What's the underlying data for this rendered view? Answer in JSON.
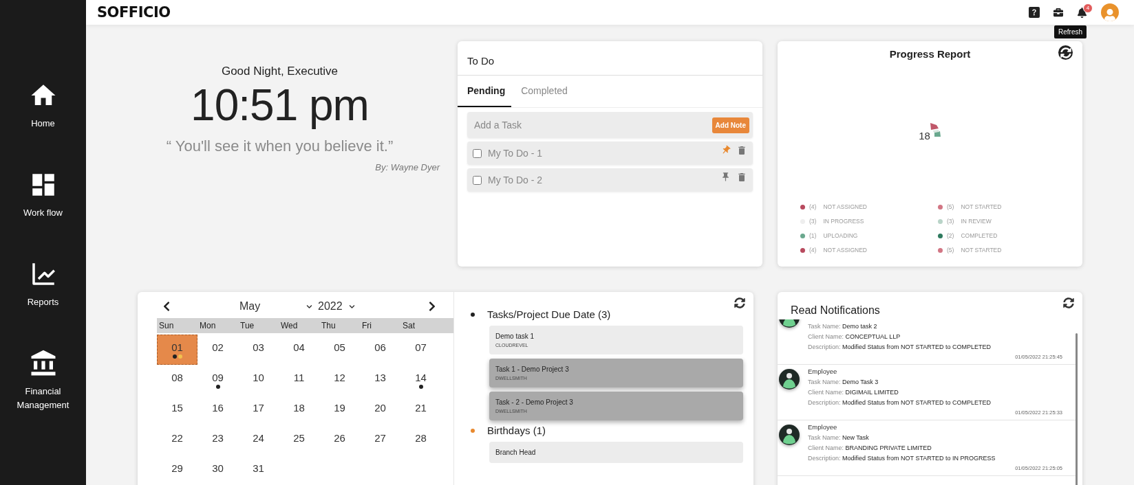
{
  "app": {
    "logo": "SOFFICIO"
  },
  "sidebar": {
    "items": [
      {
        "label": "Home",
        "kind": "home"
      },
      {
        "label": "Work flow",
        "kind": "workflow"
      },
      {
        "label": "Reports",
        "kind": "reports"
      },
      {
        "label": "Financial Management",
        "kind": "finance"
      }
    ]
  },
  "topbar": {
    "notification_count": "4"
  },
  "greeting": {
    "salutation": "Good Night, Executive",
    "time": "10:51 pm",
    "quote": "“ You'll see it when you believe it.”",
    "author": "By: Wayne Dyer"
  },
  "todo": {
    "title": "To Do",
    "tabs": [
      {
        "label": "Pending",
        "selected": true
      },
      {
        "label": "Completed",
        "selected": false
      }
    ],
    "input": {
      "placeholder": "Add a Task"
    },
    "add_button": "Add Note",
    "items": [
      {
        "label": "My To Do - 1",
        "checked": false,
        "pinned": true
      },
      {
        "label": "My To Do - 2",
        "checked": false,
        "pinned": false
      }
    ]
  },
  "progress_report": {
    "title": "Progress Report",
    "tooltip": "Refresh",
    "total": "18",
    "legend": [
      {
        "count": "(4)",
        "label": "NOT ASSIGNED",
        "color": "#b84a5e"
      },
      {
        "count": "(5)",
        "label": "NOT STARTED",
        "color": "#d27684"
      },
      {
        "count": "(3)",
        "label": "IN PROGRESS",
        "color": "#eeeeee"
      },
      {
        "count": "(3)",
        "label": "IN REVIEW",
        "color": "#b9d4c8"
      },
      {
        "count": "(1)",
        "label": "UPLOADING",
        "color": "#6aa88e"
      },
      {
        "count": "(2)",
        "label": "COMPLETED",
        "color": "#2e7a5e"
      },
      {
        "count": "(4)",
        "label": "NOT ASSIGNED",
        "color": "#b84a5e"
      },
      {
        "count": "(5)",
        "label": "NOT STARTED",
        "color": "#d27684"
      }
    ]
  },
  "calendar": {
    "month": "May",
    "year": "2022",
    "weekdays": [
      "Sun",
      "Mon",
      "Tue",
      "Wed",
      "Thu",
      "Fri",
      "Sat"
    ],
    "days": [
      {
        "day": "01",
        "selected": true,
        "dots": [
          {
            "color": "#222222"
          },
          {
            "color": "#f2c14e"
          }
        ]
      },
      {
        "day": "02",
        "selected": false
      },
      {
        "day": "03",
        "selected": false
      },
      {
        "day": "04",
        "selected": false
      },
      {
        "day": "05",
        "selected": false
      },
      {
        "day": "06",
        "selected": false
      },
      {
        "day": "07",
        "selected": false
      },
      {
        "day": "08",
        "selected": false
      },
      {
        "day": "09",
        "selected": false,
        "dots": [
          {
            "color": "#222222"
          }
        ]
      },
      {
        "day": "10",
        "selected": false
      },
      {
        "day": "11",
        "selected": false
      },
      {
        "day": "12",
        "selected": false
      },
      {
        "day": "13",
        "selected": false
      },
      {
        "day": "14",
        "selected": false,
        "dots": [
          {
            "color": "#222222"
          }
        ]
      },
      {
        "day": "15",
        "selected": false
      },
      {
        "day": "16",
        "selected": false
      },
      {
        "day": "17",
        "selected": false
      },
      {
        "day": "18",
        "selected": false
      },
      {
        "day": "19",
        "selected": false
      },
      {
        "day": "20",
        "selected": false
      },
      {
        "day": "21",
        "selected": false
      },
      {
        "day": "22",
        "selected": false
      },
      {
        "day": "23",
        "selected": false
      },
      {
        "day": "24",
        "selected": false
      },
      {
        "day": "25",
        "selected": false
      },
      {
        "day": "26",
        "selected": false
      },
      {
        "day": "27",
        "selected": false
      },
      {
        "day": "28",
        "selected": false
      },
      {
        "day": "29",
        "selected": false
      },
      {
        "day": "30",
        "selected": false
      },
      {
        "day": "31",
        "selected": false
      }
    ]
  },
  "agenda": {
    "sections": [
      {
        "title": "Tasks/Project Due Date (3)",
        "color": "#222222",
        "items": [
          {
            "title": "Demo task 1",
            "client": "CLOUDREVEL",
            "highlighted": false
          },
          {
            "title": "Task 1 - Demo Project 3",
            "client": "DWELLSMITH",
            "highlighted": true
          },
          {
            "title": "Task - 2 - Demo Project 3",
            "client": "DWELLSMITH",
            "highlighted": true
          }
        ]
      },
      {
        "title": "Birthdays (1)",
        "color": "#e8892f",
        "items": [
          {
            "title": "Branch Head",
            "highlighted": false
          }
        ]
      }
    ]
  },
  "notifications": {
    "title": "Read Notifications",
    "items": [
      {
        "task": "Task Name: **Demo task 2**",
        "client": "Client Name: **CONCEPTUAL LLP**",
        "description": "Description: **Modified Status from NOT STARTED to COMPLETED**",
        "time": "01/05/2022 21:25:45"
      },
      {
        "sender": "Employee",
        "task": "Task Name: **Demo Task 3**",
        "client": "Client Name: **DIGIMAIL LIMITED**",
        "description": "Description: **Modified Status from NOT STARTED to COMPLETED**",
        "time": "01/05/2022 21:25:33"
      },
      {
        "sender": "Employee",
        "task": "Task Name: **New Task**",
        "client": "Client Name: **BRANDING PRIVATE LIMITED**",
        "description": "Description: **Modified Status from NOT STARTED to IN PROGRESS**",
        "time": "01/05/2022 21:25:05"
      }
    ]
  }
}
